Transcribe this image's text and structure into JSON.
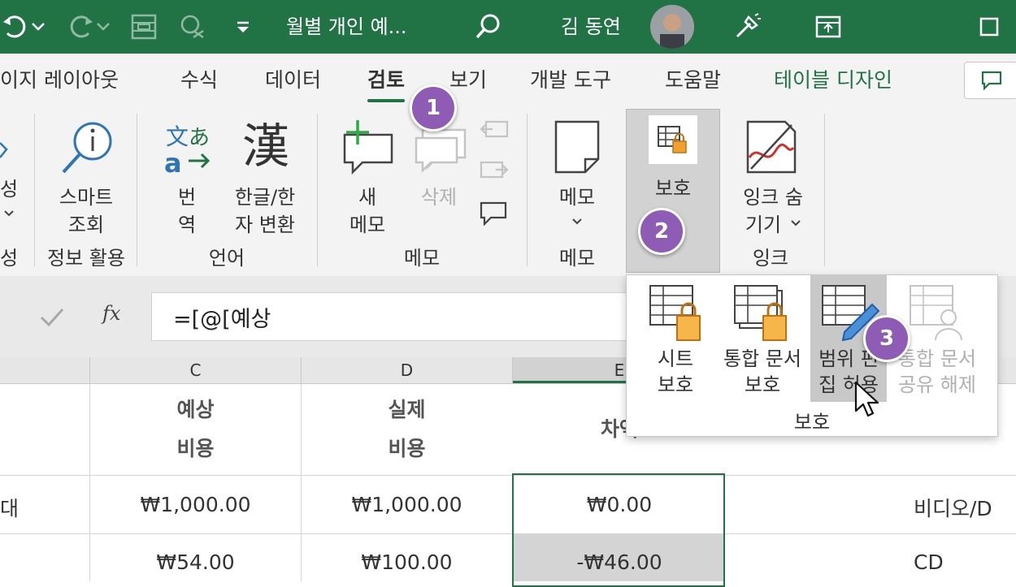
{
  "titlebar": {
    "doc_title": "월별 개인 예...",
    "user_name": "김 동연",
    "icons": [
      "undo-icon",
      "dropdown-icon",
      "redo-icon",
      "dropdown-icon",
      "form-icon",
      "shapes-icon",
      "customize-qat-icon",
      "search-icon",
      "avatar",
      "idea-icon",
      "ribbon-display-icon",
      "maximize-icon"
    ]
  },
  "tabs": [
    "이지 레이아웃",
    "수식",
    "데이터",
    "검토",
    "보기",
    "개발 도구",
    "도움말",
    "테이블 디자인"
  ],
  "ribbon": {
    "g0": {
      "label_top": "성",
      "label_group": "성"
    },
    "smart": {
      "label1": "스마트",
      "label2": "조회",
      "group": "정보 활용"
    },
    "translate": {
      "label1": "번",
      "label2": "역"
    },
    "hanja": {
      "label1": "한글/한",
      "label2": "자 변환",
      "glyph": "漢"
    },
    "lang_group": "언어",
    "new_memo": {
      "label1": "새",
      "label2": "메모"
    },
    "delete_memo": "삭제",
    "memo_group": "메모",
    "memo": {
      "label": "메모",
      "group": "메모"
    },
    "protect": {
      "label": "보호"
    },
    "ink": {
      "label1": "잉크 숨",
      "label2": "기기",
      "group": "잉크"
    }
  },
  "formula_bar": {
    "fx": "fx",
    "content": "=[@[예상"
  },
  "columns": [
    "C",
    "D",
    "E"
  ],
  "header_cells": {
    "c_line1": "예상",
    "c_line2": "비용",
    "d_line1": "실제",
    "d_line2": "비용",
    "e_label": "차액"
  },
  "rows": [
    {
      "b": "대",
      "c": "₩1,000.00",
      "d": "₩1,000.00",
      "e": "₩0.00",
      "g": "비디오/D"
    },
    {
      "b": "",
      "c": "₩54.00",
      "d": "₩100.00",
      "e": "-₩46.00",
      "g": "CD"
    }
  ],
  "popup": {
    "items": [
      {
        "line1": "시트",
        "line2": "보호"
      },
      {
        "line1": "통합 문서",
        "line2": "보호"
      },
      {
        "line1": "범위 편",
        "line2": "집 허용"
      },
      {
        "line1": "통합 문서",
        "line2": "공유 해제"
      }
    ],
    "group": "보호"
  },
  "badges": [
    "1",
    "2",
    "3"
  ],
  "colors": {
    "excel_green": "#217346",
    "badge_purple": "#8e5bb5",
    "lock_orange": "#f0a030"
  }
}
